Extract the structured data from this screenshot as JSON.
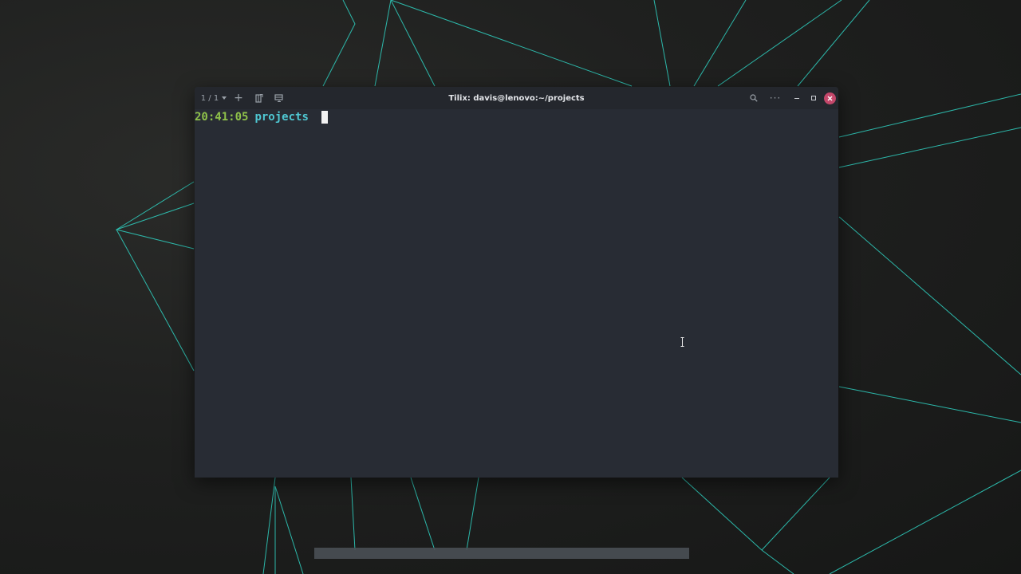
{
  "window": {
    "title": "Tilix: davis@lenovo:~/projects",
    "session_indicator": "1 / 1"
  },
  "toolbar": {
    "add_label": "+",
    "menu_label": "···"
  },
  "terminal": {
    "prompt_time": "20:41:05",
    "prompt_dir": "projects"
  },
  "icons": {
    "session": "chevron-down-icon",
    "add": "plus-icon",
    "split_right": "split-right-icon",
    "split_down": "split-down-icon",
    "search": "search-icon",
    "menu": "ellipsis-icon",
    "minimize": "minimize-icon",
    "maximize": "maximize-icon",
    "close": "close-icon"
  },
  "colors": {
    "terminal_bg": "#282c34",
    "titlebar_bg": "#24272d",
    "prompt_time": "#8fc24a",
    "prompt_dir": "#4fc8d3",
    "close_button": "#c4476a",
    "wallpaper_lines": "#2fd3c3"
  }
}
